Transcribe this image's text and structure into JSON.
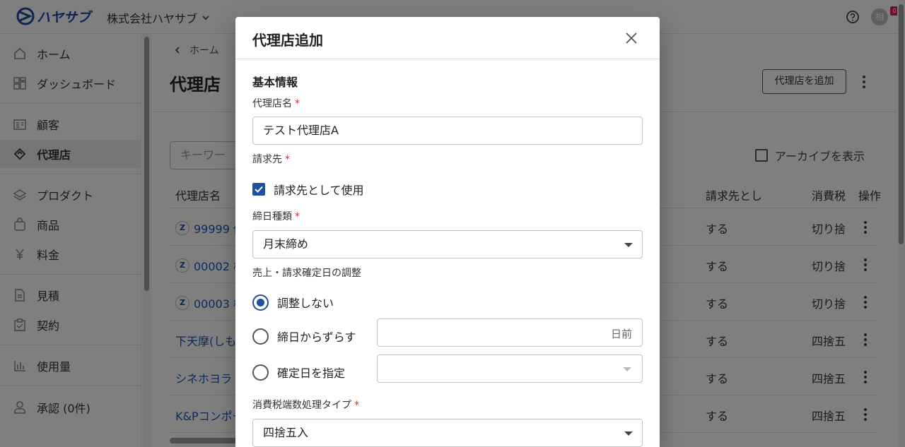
{
  "app": {
    "logo_text": "ハヤサブ",
    "company": "株式会社ハヤサブ",
    "avatar_initial": "相",
    "notif_badge": "0"
  },
  "sidebar": {
    "items": [
      {
        "label": "ホーム",
        "icon": "home-icon"
      },
      {
        "label": "ダッシュボード",
        "icon": "dashboard-icon"
      },
      {
        "label": "顧客",
        "icon": "customer-icon"
      },
      {
        "label": "代理店",
        "icon": "agency-icon"
      },
      {
        "label": "プロダクト",
        "icon": "layers-icon"
      },
      {
        "label": "商品",
        "icon": "bag-icon"
      },
      {
        "label": "料金",
        "icon": "yen-icon"
      },
      {
        "label": "見積",
        "icon": "document-icon"
      },
      {
        "label": "契約",
        "icon": "contract-icon"
      },
      {
        "label": "使用量",
        "icon": "bar-chart-icon"
      },
      {
        "label": "承認 (0件)",
        "icon": "user-approval-icon"
      }
    ]
  },
  "main": {
    "breadcrumb": "ホーム",
    "title": "代理店",
    "add_button": "代理店を追加",
    "search_placeholder": "キーワー",
    "archive_label": "アーカイブを表示",
    "columns": [
      "代理店名",
      "請求先とし",
      "消費税",
      "操作"
    ],
    "rows": [
      {
        "badge": "Z",
        "name": "99999 仮",
        "billing": "する",
        "tax": "切り捨"
      },
      {
        "badge": "Z",
        "name": "00002 株",
        "billing": "する",
        "tax": "切り捨"
      },
      {
        "badge": "Z",
        "name": "00003 株",
        "billing": "する",
        "tax": "切り捨"
      },
      {
        "badge": "",
        "name": "下天摩(しも",
        "billing": "する",
        "tax": "四捨五"
      },
      {
        "badge": "",
        "name": "シネホヨラ",
        "billing": "する",
        "tax": "四捨五"
      },
      {
        "badge": "",
        "name": "K&Pコンポー",
        "billing": "する",
        "tax": "四捨五"
      }
    ]
  },
  "dialog": {
    "title": "代理店追加",
    "section_basic": "基本情報",
    "agency_name_label": "代理店名",
    "agency_name_value": "テスト代理店A",
    "billing_label": "請求先",
    "billing_checkbox": "請求先として使用",
    "closing_label": "締日種類",
    "closing_value": "月末締め",
    "adjust_label": "売上・請求確定日の調整",
    "radio_none": "調整しない",
    "radio_shift": "締日からずらす",
    "shift_suffix": "日前",
    "radio_specify": "確定日を指定",
    "tax_label": "消費税端数処理タイプ",
    "tax_value": "四捨五入",
    "required_mark": "*"
  }
}
